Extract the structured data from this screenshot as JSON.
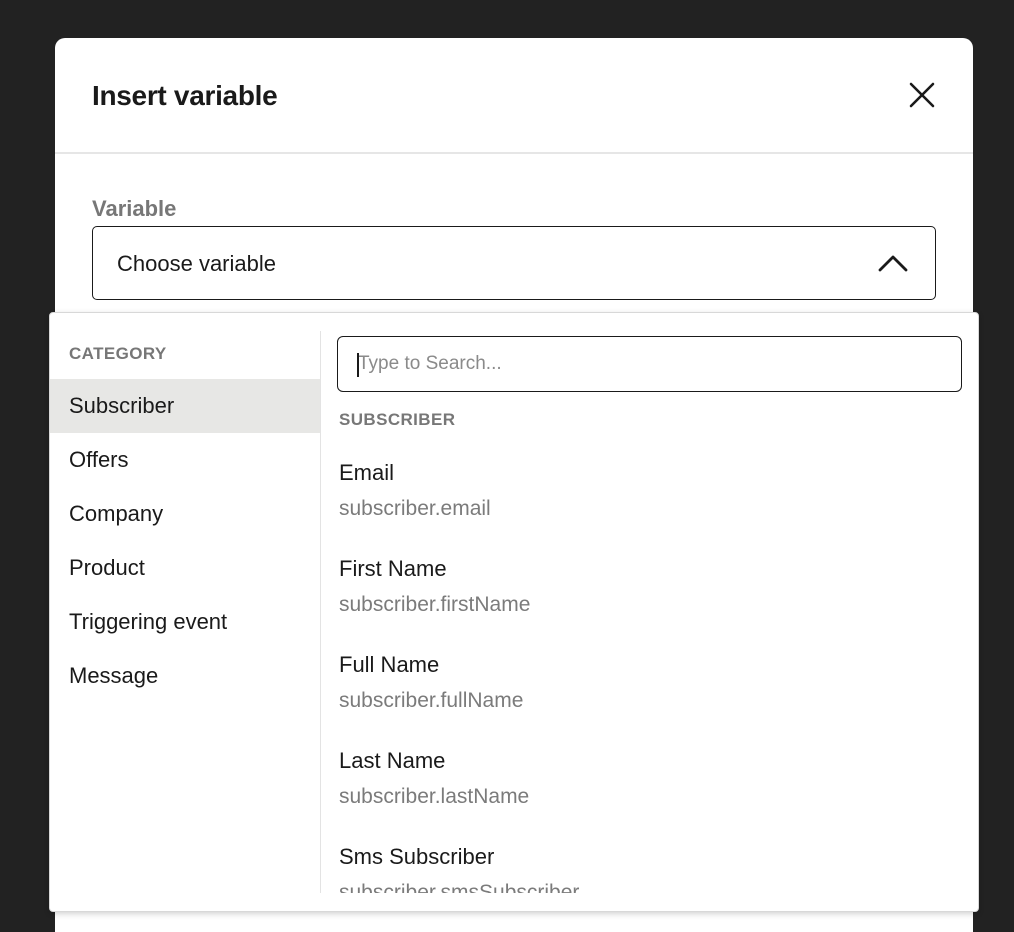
{
  "modal": {
    "title": "Insert variable",
    "close_icon": "close-icon"
  },
  "field": {
    "label": "Variable",
    "selected_value": "Choose variable",
    "chevron_icon": "chevron-up-icon"
  },
  "dropdown": {
    "category_header": "CATEGORY",
    "categories": [
      {
        "label": "Subscriber",
        "active": true
      },
      {
        "label": "Offers",
        "active": false
      },
      {
        "label": "Company",
        "active": false
      },
      {
        "label": "Product",
        "active": false
      },
      {
        "label": "Triggering event",
        "active": false
      },
      {
        "label": "Message",
        "active": false
      }
    ],
    "search": {
      "placeholder": "Type to Search...",
      "value": ""
    },
    "section_header": "SUBSCRIBER",
    "variables": [
      {
        "name": "Email",
        "path": "subscriber.email"
      },
      {
        "name": "First Name",
        "path": "subscriber.firstName"
      },
      {
        "name": "Full Name",
        "path": "subscriber.fullName"
      },
      {
        "name": "Last Name",
        "path": "subscriber.lastName"
      },
      {
        "name": "Sms Subscriber",
        "path": "subscriber.smsSubscriber"
      }
    ]
  },
  "colors": {
    "backdrop": "#222222",
    "active_category_bg": "#e7e7e5",
    "muted_text": "#777777"
  }
}
